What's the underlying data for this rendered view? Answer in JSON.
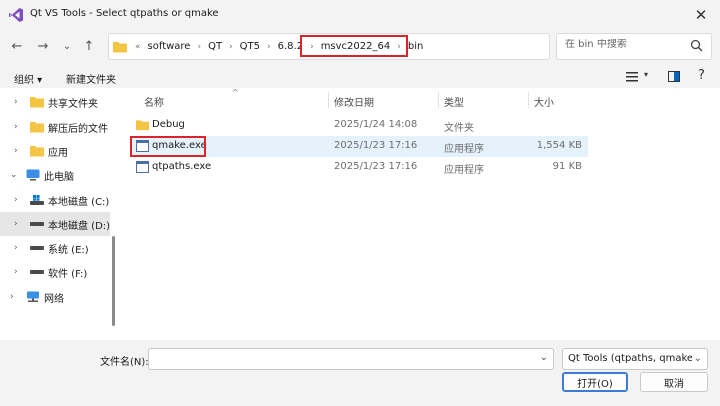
{
  "window": {
    "title": "Qt VS Tools - Select qtpaths or qmake",
    "close_glyph": "✕"
  },
  "navigation": {
    "back_glyph": "←",
    "forward_glyph": "→",
    "recent_glyph": "⌄",
    "up_glyph": "↑",
    "breadcrumb_overflow": "«",
    "breadcrumbs": [
      "software",
      "QT",
      "QT5",
      "6.8.2",
      "msvc2022_64",
      "bin"
    ],
    "refresh_glyph": "↻",
    "dropdown_glyph": "⌄"
  },
  "search": {
    "placeholder": "在 bin 中搜索",
    "icon": "search-icon"
  },
  "toolbar": {
    "organize_label": "组织 ▾",
    "new_folder_label": "新建文件夹"
  },
  "sidebar": {
    "items": [
      {
        "label": "共享文件夹",
        "icon": "folder-icon"
      },
      {
        "label": "解压后的文件",
        "icon": "folder-icon"
      },
      {
        "label": "应用",
        "icon": "folder-icon"
      },
      {
        "label": "此电脑",
        "icon": "computer-icon"
      },
      {
        "label": "本地磁盘 (C:)",
        "icon": "windows-drive-icon"
      },
      {
        "label": "本地磁盘 (D:)",
        "icon": "drive-icon"
      },
      {
        "label": "系统 (E:)",
        "icon": "drive-icon"
      },
      {
        "label": "软件 (F:)",
        "icon": "drive-icon"
      },
      {
        "label": "网络",
        "icon": "network-icon"
      }
    ]
  },
  "columns": {
    "name": "名称",
    "date": "修改日期",
    "type": "类型",
    "size": "大小"
  },
  "files": [
    {
      "name": "Debug",
      "date": "2025/1/24 14:08",
      "type": "文件夹",
      "size": "",
      "icon": "folder-icon"
    },
    {
      "name": "qmake.exe",
      "date": "2025/1/23 17:16",
      "type": "应用程序",
      "size": "1,554 KB",
      "icon": "exe-icon"
    },
    {
      "name": "qtpaths.exe",
      "date": "2025/1/23 17:16",
      "type": "应用程序",
      "size": "91 KB",
      "icon": "exe-icon"
    }
  ],
  "footer": {
    "filename_label": "文件名(N):",
    "filename_value": "",
    "filter_value": "Qt Tools (qtpaths, qmake) (qtpaths.exe;qmake.exe)",
    "open_label": "打开(O)",
    "cancel_label": "取消"
  },
  "colors": {
    "accent": "#0067c0",
    "highlight_box": "#d8252b",
    "folder": "#f4c542"
  }
}
